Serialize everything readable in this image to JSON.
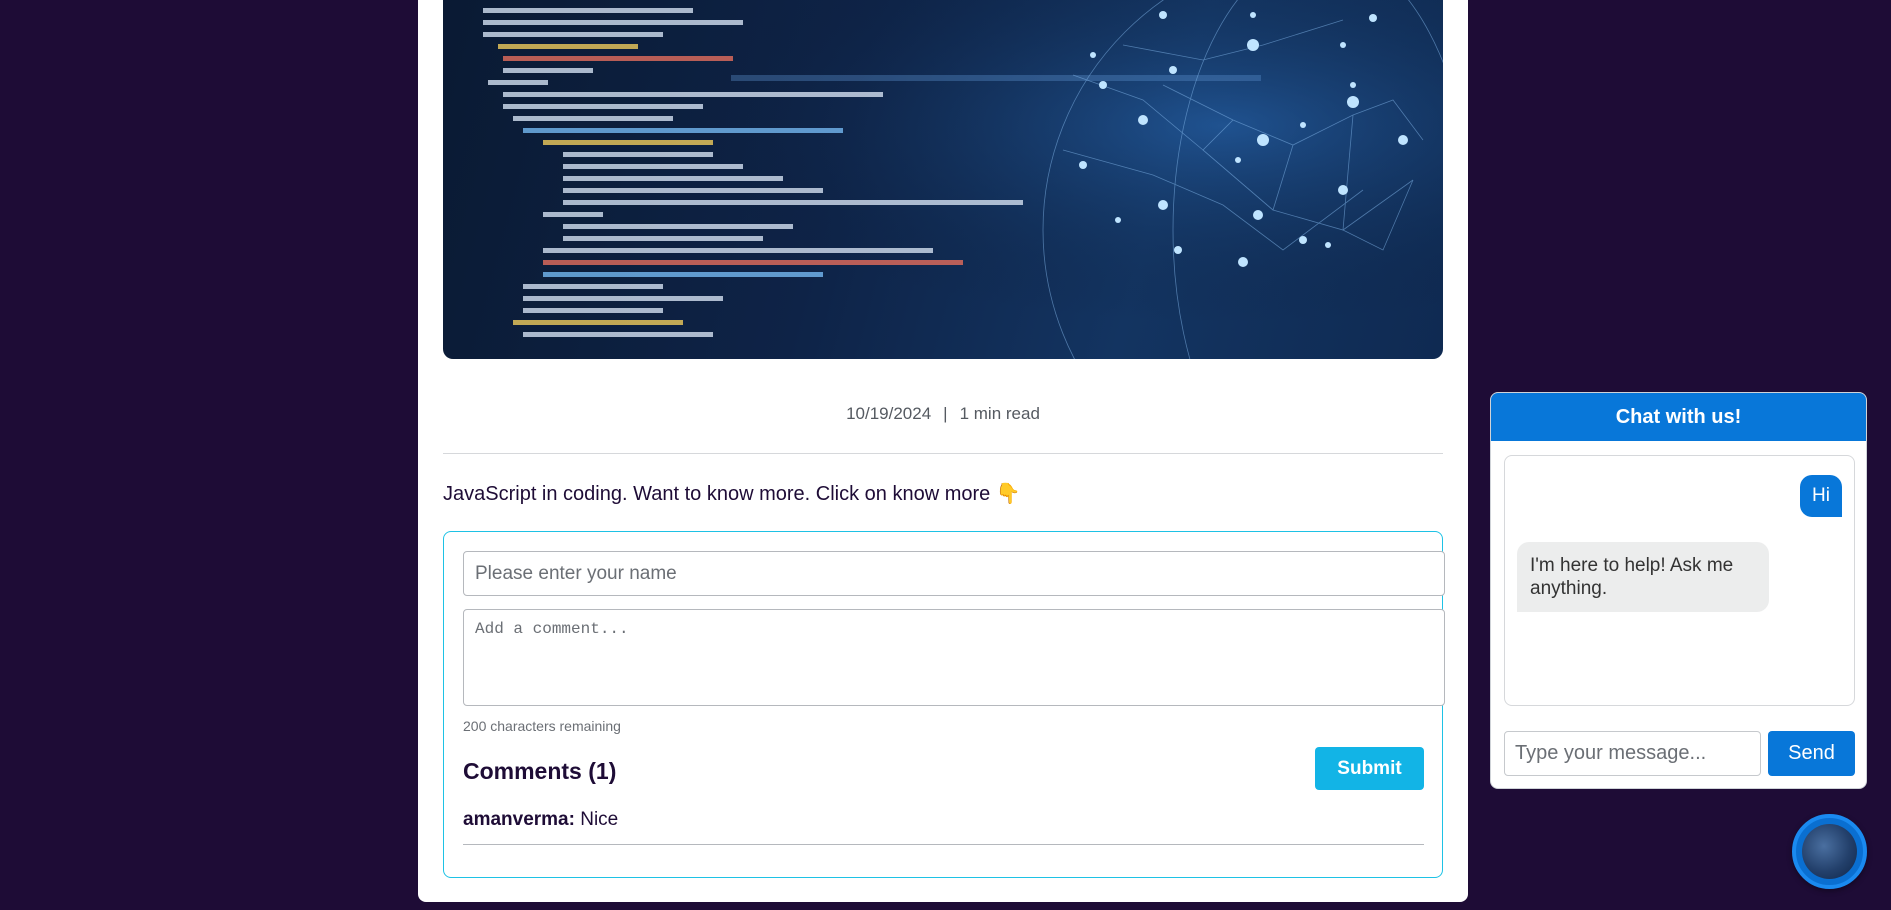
{
  "article": {
    "date": "10/19/2024",
    "separator": "|",
    "read_time": "1 min read",
    "excerpt": "JavaScript in coding. Want to know more. Click on know more 👇"
  },
  "comment_form": {
    "name_placeholder": "Please enter your name",
    "comment_placeholder": "Add a comment...",
    "chars_remaining": "200 characters remaining",
    "comments_heading": "Comments (1)",
    "submit_label": "Submit"
  },
  "comments": [
    {
      "author": "amanverma:",
      "text": "Nice"
    }
  ],
  "chat": {
    "title": "Chat with us!",
    "messages": [
      {
        "from": "user",
        "text": "Hi"
      },
      {
        "from": "bot",
        "text": "I'm here to help! Ask me anything."
      }
    ],
    "input_placeholder": "Type your message...",
    "send_label": "Send"
  },
  "colors": {
    "page_background": "#1e0c36",
    "accent_cyan": "#12b4e6",
    "chat_blue": "#0877d9"
  },
  "icons": {
    "chat_launcher": "chat-avatar-icon"
  }
}
